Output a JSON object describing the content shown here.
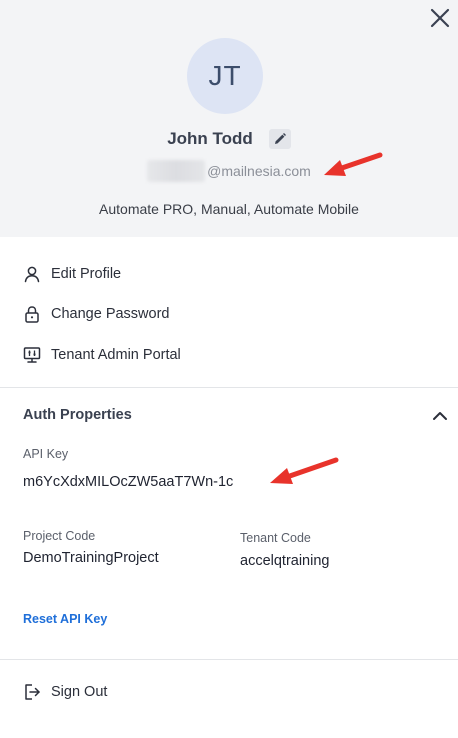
{
  "profile": {
    "initials": "JT",
    "name": "John Todd",
    "email_domain": "@mailnesia.com",
    "licenses": "Automate PRO, Manual, Automate Mobile"
  },
  "menu": {
    "edit_profile": "Edit Profile",
    "change_password": "Change Password",
    "tenant_admin_portal": "Tenant Admin Portal"
  },
  "auth": {
    "section_title": "Auth Properties",
    "api_key_label": "API Key",
    "api_key_value": "m6YcXdxMILOcZW5aaT7Wn-1c",
    "project_code_label": "Project Code",
    "project_code_value": "DemoTrainingProject",
    "tenant_code_label": "Tenant Code",
    "tenant_code_value": "accelqtraining",
    "reset_label": "Reset API Key"
  },
  "footer": {
    "sign_out": "Sign Out"
  },
  "colors": {
    "header_bg": "#f3f4f6",
    "avatar_bg": "#dde4f4",
    "link": "#1f6fd9",
    "annotation_arrow": "#e8332b"
  }
}
